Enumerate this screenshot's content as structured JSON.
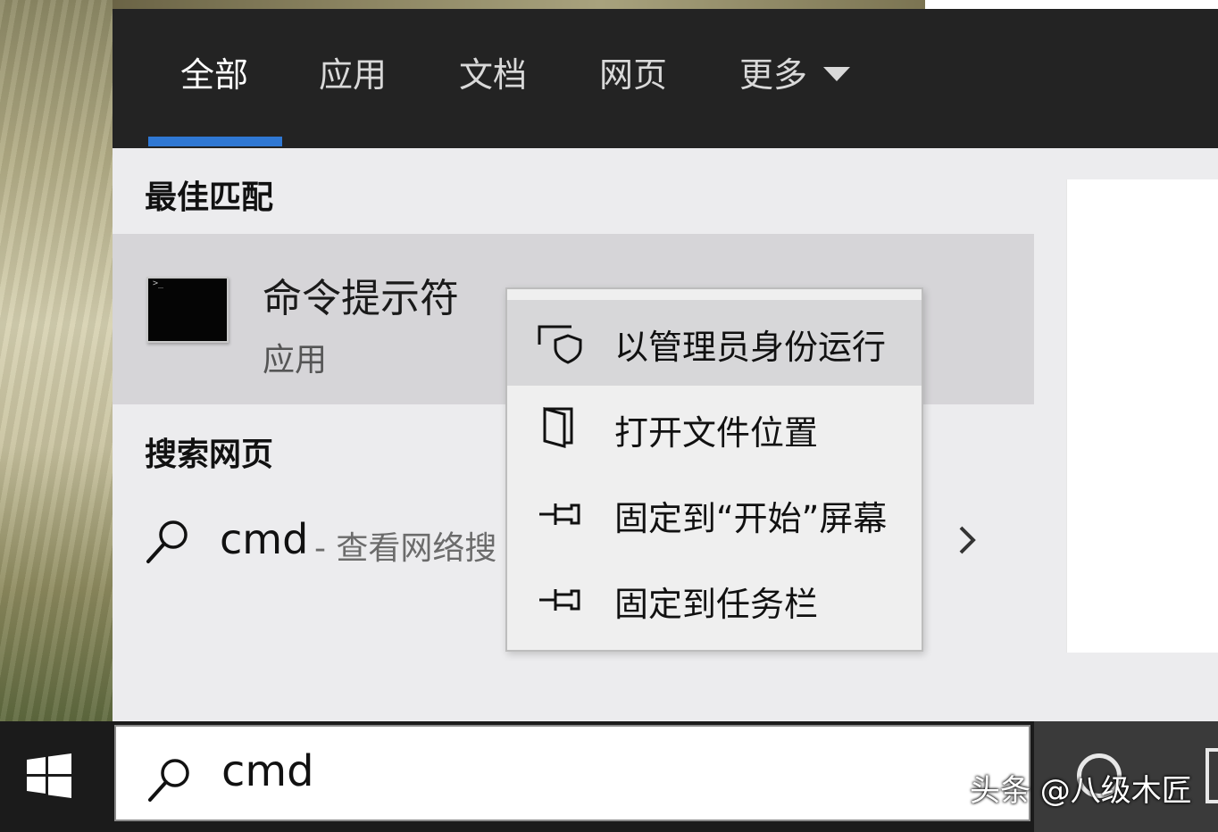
{
  "tabs": [
    {
      "label": "全部",
      "active": true
    },
    {
      "label": "应用"
    },
    {
      "label": "文档"
    },
    {
      "label": "网页"
    },
    {
      "label": "更多",
      "dropdown": true
    }
  ],
  "best_match": {
    "heading": "最佳匹配",
    "title": "命令提示符",
    "subtitle": "应用",
    "icon": "command-prompt-icon"
  },
  "web_search": {
    "heading": "搜索网页",
    "query": "cmd",
    "hint": "- 查看网络搜",
    "icon": "search-icon"
  },
  "context_menu": {
    "items": [
      {
        "label": "以管理员身份运行",
        "icon": "shield-icon",
        "highlighted": true
      },
      {
        "label": "打开文件位置",
        "icon": "folder-icon"
      },
      {
        "label": "固定到“开始”屏幕",
        "icon": "pin-icon"
      },
      {
        "label": "固定到任务栏",
        "icon": "pin-icon"
      }
    ]
  },
  "taskbar": {
    "search_value": "cmd",
    "start_icon": "windows-logo-icon"
  },
  "watermark": "头条 @八级木匠",
  "colors": {
    "accent": "#2f78d4",
    "tabbar_bg": "#232323",
    "panel_bg": "#ececee",
    "highlight_bg": "#d6d5d8"
  }
}
